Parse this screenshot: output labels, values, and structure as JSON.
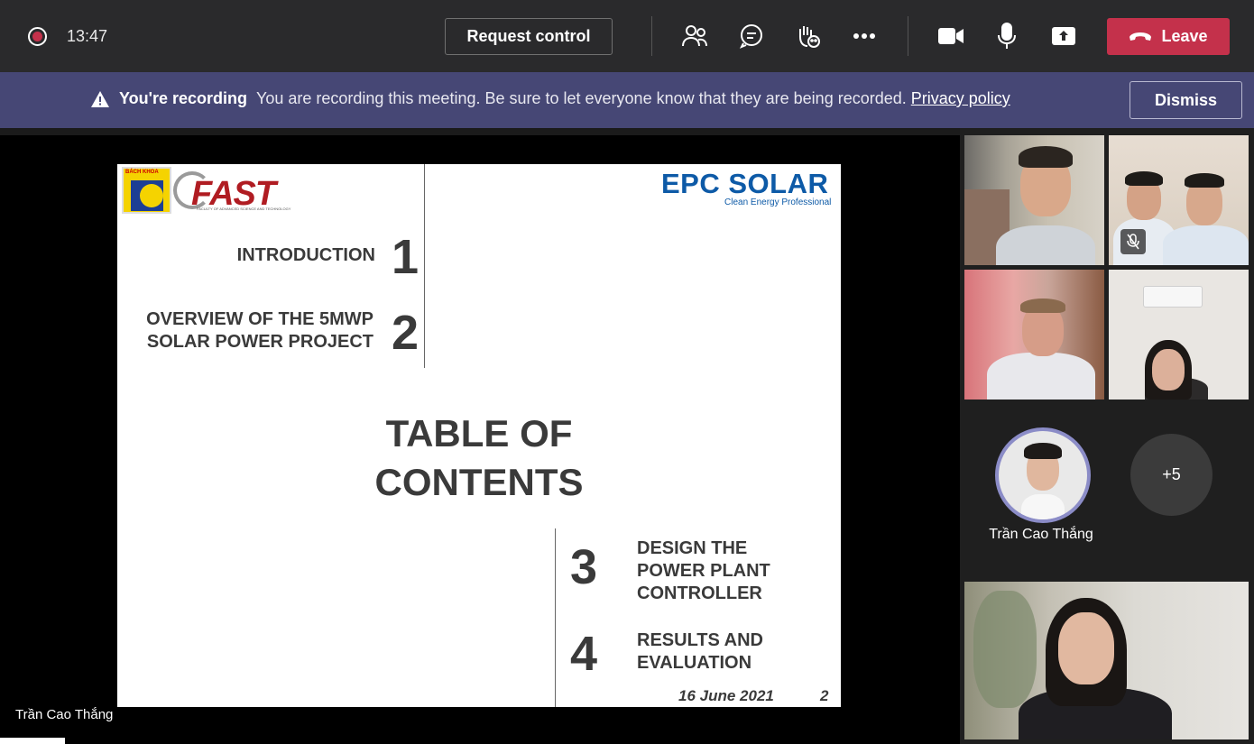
{
  "topbar": {
    "timer": "13:47",
    "request_control_label": "Request control",
    "leave_label": "Leave",
    "icons": [
      "participants-icon",
      "chat-icon",
      "raise-hand-icon",
      "more-options-icon",
      "camera-icon",
      "microphone-icon",
      "share-screen-icon"
    ]
  },
  "banner": {
    "title": "You're recording",
    "message": "You are recording this meeting. Be sure to let everyone know that they are being recorded.",
    "link": "Privacy policy",
    "dismiss_label": "Dismiss"
  },
  "slide": {
    "logo_left_text": "BÁCH KHOA",
    "logo_fast": "FAST",
    "logo_fast_sub": "FACULTY OF ADVANCED SCIENCE AND TECHNOLOGY",
    "logo_epc": "EPC SOLAR",
    "logo_epc_sub": "Clean Energy Professional",
    "title_line1": "TABLE OF",
    "title_line2": "CONTENTS",
    "items": [
      {
        "num": "1",
        "line1": "INTRODUCTION",
        "line2": ""
      },
      {
        "num": "2",
        "line1": "OVERVIEW OF THE 5MWP",
        "line2": "SOLAR POWER PROJECT"
      },
      {
        "num": "3",
        "line1": "DESIGN THE",
        "line2": "POWER PLANT",
        "line3": "CONTROLLER"
      },
      {
        "num": "4",
        "line1": "RESULTS AND",
        "line2": "EVALUATION"
      }
    ],
    "date": "16 June 2021",
    "page_number": "2"
  },
  "presenter": {
    "name": "Trần Cao Thắng"
  },
  "participants": {
    "avatar_name": "Trần Cao Thắng",
    "more_count": "+5"
  },
  "colors": {
    "topbar": "#2a2a2c",
    "banner": "#464775",
    "leave": "#c4314b",
    "avatar_ring": "#8b8cc7"
  }
}
